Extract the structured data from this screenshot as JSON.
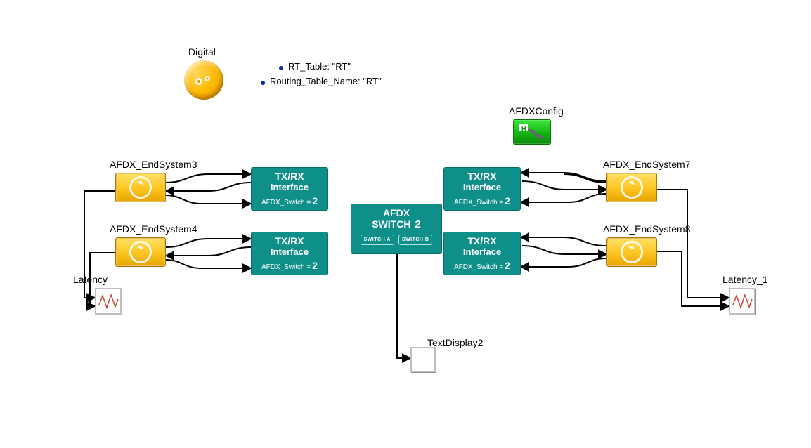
{
  "top": {
    "digital_label": "Digital",
    "param_rt_table": "RT_Table: \"RT\"",
    "param_routing_table_name": "Routing_Table_Name: \"RT\""
  },
  "afdxconfig": {
    "label": "AFDXConfig",
    "tag": "H"
  },
  "endsystems": {
    "es3": {
      "label": "AFDX_EndSystem3"
    },
    "es4": {
      "label": "AFDX_EndSystem4"
    },
    "es7": {
      "label": "AFDX_EndSystem7"
    },
    "es8": {
      "label": "AFDX_EndSystem8"
    }
  },
  "txrx": {
    "line1": "TX/RX",
    "line2": "Interface",
    "switch_prefix": "AFDX_Switch =",
    "switch_value": "2"
  },
  "switch": {
    "title_l1": "AFDX",
    "title_l2": "SWITCH",
    "index": "2",
    "sub_a": "SWITCH A",
    "sub_b": "SWITCH B"
  },
  "scopes": {
    "latency": "Latency",
    "latency_1": "Latency_1"
  },
  "textdisplay": {
    "label": "TextDisplay2"
  }
}
